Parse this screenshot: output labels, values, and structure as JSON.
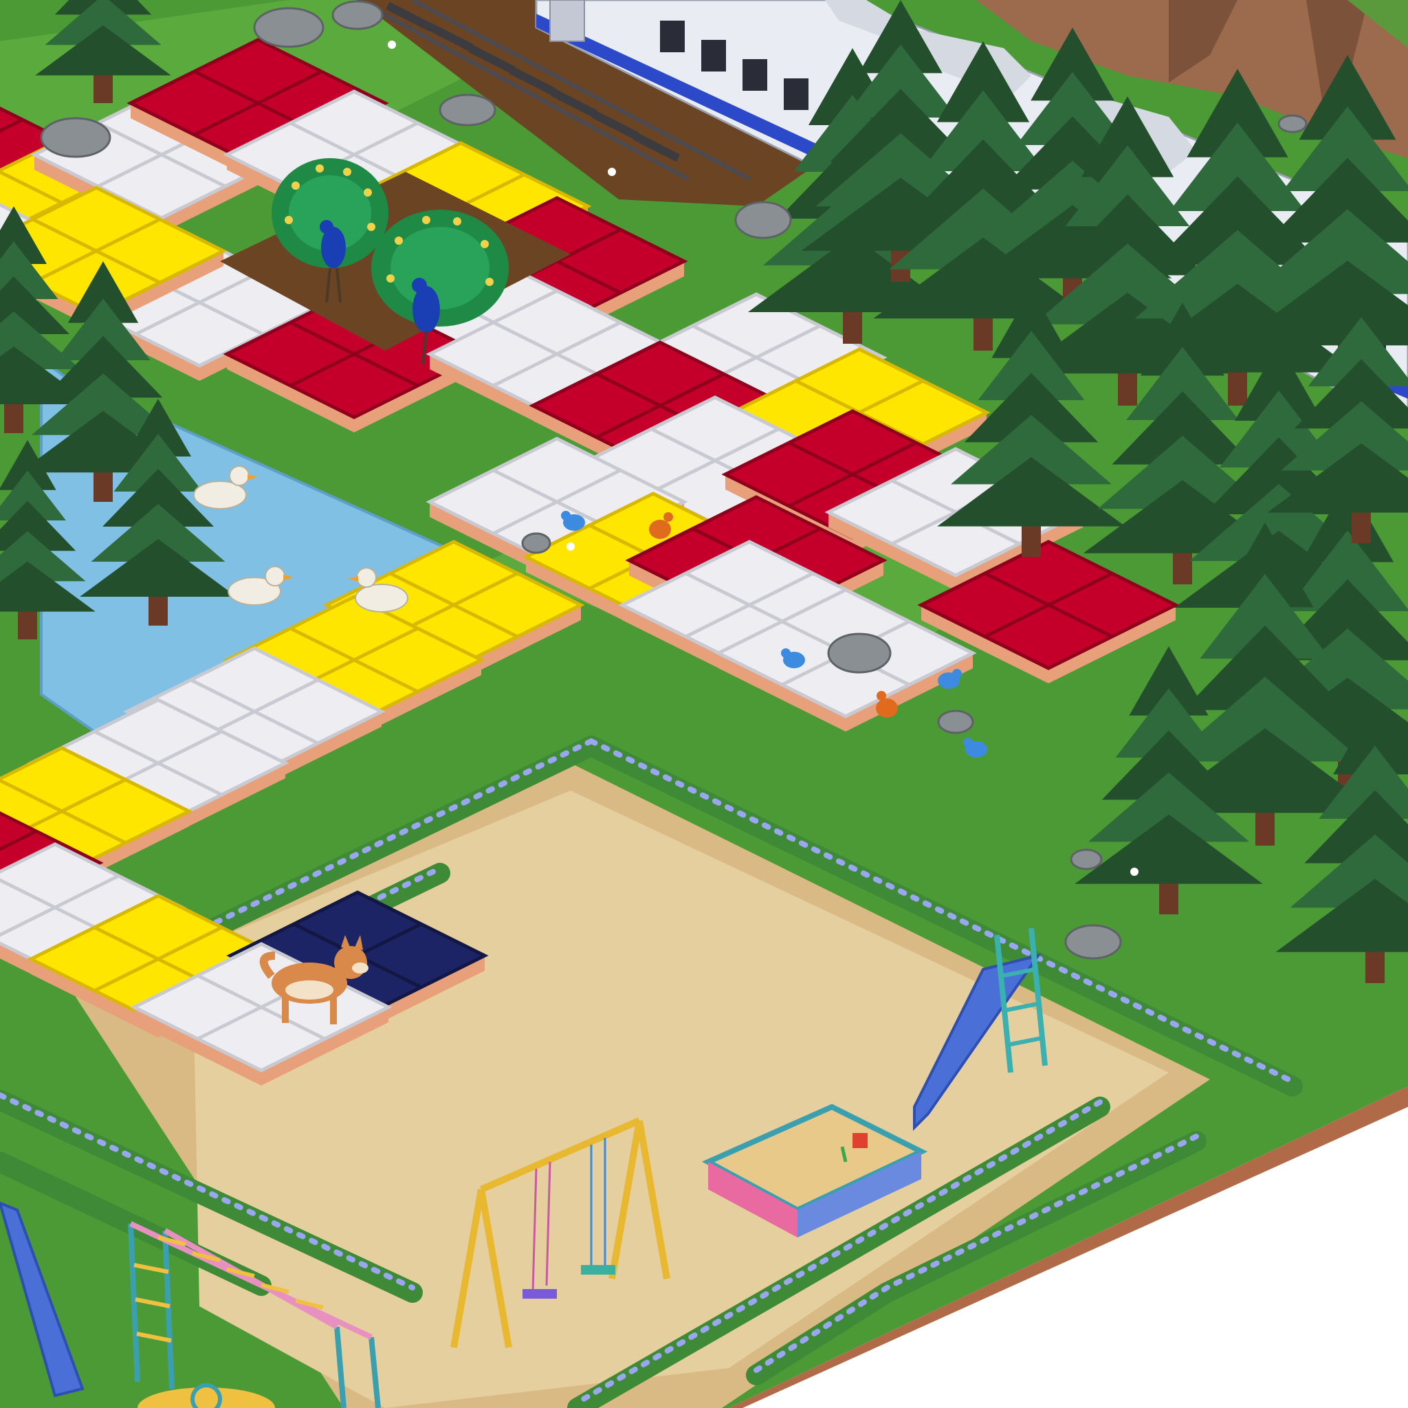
{
  "scene": {
    "kind": "isometric board game",
    "palette": {
      "grass": "#4c9a36",
      "grass_light": "#67b347",
      "grass_dark": "#2f6f22",
      "soil": "#6b4424",
      "sand": "#e6cf9e",
      "water": "#7fc0e4",
      "tile_red": "#c4002a",
      "tile_red_dark": "#8f001d",
      "tile_yellow": "#ffe600",
      "tile_yellow_dark": "#d8b800",
      "tile_white": "#eeeef2",
      "tile_white_dark": "#c9c9d2",
      "tile_navy": "#1d2466",
      "tile_navy_dark": "#121744",
      "tile_edge": "#e8a07a",
      "hedge": "#3e8a36",
      "hedge_flower": "#9aa6f0",
      "pine": "#244f2d",
      "pine_light": "#2f6a3c",
      "trunk": "#6b3a27",
      "rock": "#8a8f93",
      "train_body": "#e9ecf2",
      "train_stripe": "#2b49c9",
      "cliff": "#9c6a4c",
      "ground_edge": "#b06a48"
    },
    "board_path": [
      {
        "color": "red"
      },
      {
        "color": "yellow"
      },
      {
        "color": "white"
      },
      {
        "color": "white"
      },
      {
        "color": "red"
      },
      {
        "color": "white"
      },
      {
        "color": "white"
      },
      {
        "color": "yellow"
      },
      {
        "color": "red"
      },
      {
        "color": "yellow"
      },
      {
        "color": "white"
      },
      {
        "color": "red"
      },
      {
        "color": "white"
      },
      {
        "color": "white"
      },
      {
        "color": "red"
      },
      {
        "color": "yellow"
      },
      {
        "color": "white"
      },
      {
        "color": "red"
      },
      {
        "color": "white"
      },
      {
        "color": "white"
      },
      {
        "color": "yellow"
      },
      {
        "color": "red"
      },
      {
        "color": "white"
      },
      {
        "color": "yellow"
      },
      {
        "color": "red"
      },
      {
        "color": "white"
      },
      {
        "color": "yellow"
      },
      {
        "color": "white"
      },
      {
        "color": "white"
      },
      {
        "color": "yellow"
      },
      {
        "color": "red"
      },
      {
        "color": "white"
      },
      {
        "color": "yellow"
      },
      {
        "color": "navy"
      },
      {
        "color": "white"
      }
    ],
    "animals": [
      "peacock",
      "peacock",
      "duck",
      "duck",
      "duck",
      "shiba-dog",
      "bluebird",
      "bluebird",
      "bluebird",
      "bluebird",
      "robin",
      "robin"
    ],
    "props": [
      "train",
      "railway-track",
      "pond",
      "playground",
      "slide",
      "slide",
      "swing-set",
      "sandbox",
      "monkey-bars",
      "pine-trees",
      "rocks",
      "flower-hedge"
    ]
  }
}
